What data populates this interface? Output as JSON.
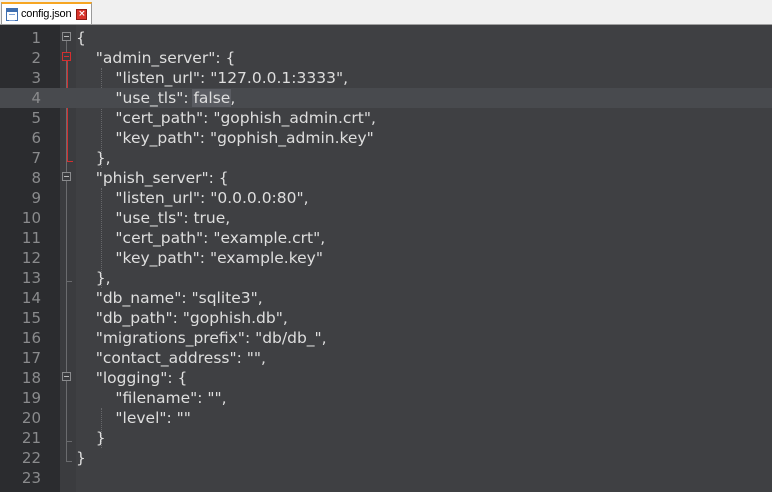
{
  "tab": {
    "filename": "config.json",
    "close_symbol": "×"
  },
  "editor": {
    "current_line": 4,
    "highlighted_word": "false",
    "lines": [
      {
        "n": "1",
        "before": "{",
        "sel": "",
        "after": ""
      },
      {
        "n": "2",
        "before": "    \"admin_server\": {",
        "sel": "",
        "after": ""
      },
      {
        "n": "3",
        "before": "        \"listen_url\": \"127.0.0.1:3333\",",
        "sel": "",
        "after": ""
      },
      {
        "n": "4",
        "before": "        \"use_tls\": ",
        "sel": "false",
        "after": ","
      },
      {
        "n": "5",
        "before": "        \"cert_path\": \"gophish_admin.crt\",",
        "sel": "",
        "after": ""
      },
      {
        "n": "6",
        "before": "        \"key_path\": \"gophish_admin.key\"",
        "sel": "",
        "after": ""
      },
      {
        "n": "7",
        "before": "    },",
        "sel": "",
        "after": ""
      },
      {
        "n": "8",
        "before": "    \"phish_server\": {",
        "sel": "",
        "after": ""
      },
      {
        "n": "9",
        "before": "        \"listen_url\": \"0.0.0.0:80\",",
        "sel": "",
        "after": ""
      },
      {
        "n": "10",
        "before": "        \"use_tls\": true,",
        "sel": "",
        "after": ""
      },
      {
        "n": "11",
        "before": "        \"cert_path\": \"example.crt\",",
        "sel": "",
        "after": ""
      },
      {
        "n": "12",
        "before": "        \"key_path\": \"example.key\"",
        "sel": "",
        "after": ""
      },
      {
        "n": "13",
        "before": "    },",
        "sel": "",
        "after": ""
      },
      {
        "n": "14",
        "before": "    \"db_name\": \"sqlite3\",",
        "sel": "",
        "after": ""
      },
      {
        "n": "15",
        "before": "    \"db_path\": \"gophish.db\",",
        "sel": "",
        "after": ""
      },
      {
        "n": "16",
        "before": "    \"migrations_prefix\": \"db/db_\",",
        "sel": "",
        "after": ""
      },
      {
        "n": "17",
        "before": "    \"contact_address\": \"\",",
        "sel": "",
        "after": ""
      },
      {
        "n": "18",
        "before": "    \"logging\": {",
        "sel": "",
        "after": ""
      },
      {
        "n": "19",
        "before": "        \"filename\": \"\",",
        "sel": "",
        "after": ""
      },
      {
        "n": "20",
        "before": "        \"level\": \"\"",
        "sel": "",
        "after": ""
      },
      {
        "n": "21",
        "before": "    }",
        "sel": "",
        "after": ""
      },
      {
        "n": "22",
        "before": "}",
        "sel": "",
        "after": ""
      },
      {
        "n": "23",
        "before": "",
        "sel": "",
        "after": ""
      }
    ]
  },
  "colors": {
    "editor_bg": "#3f4043",
    "gutter_bg": "#2b2c2f",
    "text": "#dedede",
    "line_number": "#8a8b8d",
    "fold_active": "#d32f2f",
    "tab_accent": "#f6a623"
  }
}
